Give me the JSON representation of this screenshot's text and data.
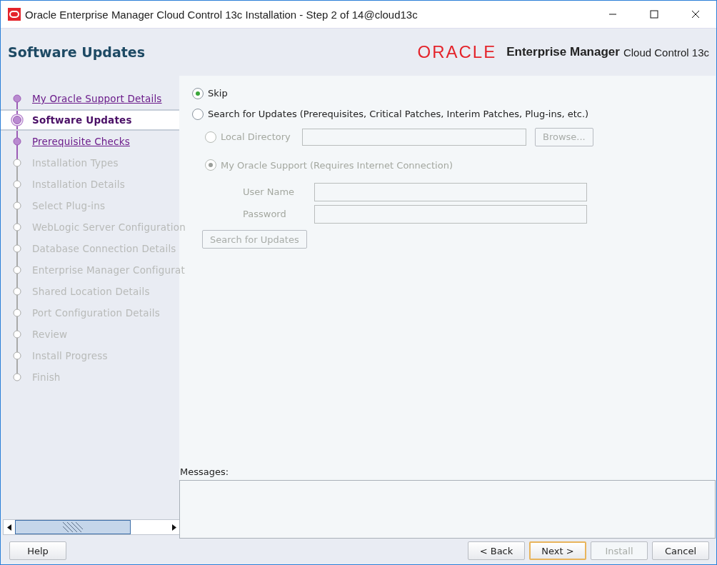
{
  "window": {
    "title": "Oracle Enterprise Manager Cloud Control 13c Installation - Step 2 of 14@cloud13c"
  },
  "header": {
    "title": "Software Updates",
    "brand": "ORACLE",
    "product": "Enterprise Manager",
    "product_suffix": "Cloud Control 13c"
  },
  "steps": [
    {
      "label": "My Oracle Support Details",
      "selected": false,
      "visited": true
    },
    {
      "label": "Software Updates",
      "selected": true,
      "visited": true
    },
    {
      "label": "Prerequisite Checks",
      "selected": false,
      "visited": true
    },
    {
      "label": "Installation Types",
      "selected": false,
      "visited": false
    },
    {
      "label": "Installation Details",
      "selected": false,
      "visited": false
    },
    {
      "label": "Select Plug-ins",
      "selected": false,
      "visited": false
    },
    {
      "label": "WebLogic Server Configuration",
      "selected": false,
      "visited": false
    },
    {
      "label": "Database Connection Details",
      "selected": false,
      "visited": false
    },
    {
      "label": "Enterprise Manager Configurat",
      "selected": false,
      "visited": false
    },
    {
      "label": "Shared Location Details",
      "selected": false,
      "visited": false
    },
    {
      "label": "Port Configuration Details",
      "selected": false,
      "visited": false
    },
    {
      "label": "Review",
      "selected": false,
      "visited": false
    },
    {
      "label": "Install Progress",
      "selected": false,
      "visited": false
    },
    {
      "label": "Finish",
      "selected": false,
      "visited": false
    }
  ],
  "options": [
    {
      "label": "Skip",
      "selected": true
    },
    {
      "label": "Search for Updates (Prerequisites, Critical Patches, Interim Patches, Plug-ins, etc.)",
      "selected": false
    }
  ],
  "local_directory": {
    "label": "Local Directory",
    "selected": false,
    "disabled": true,
    "browse": "Browse..."
  },
  "support": {
    "label": "My Oracle Support (Requires Internet Connection)",
    "selected": true,
    "disabled": true,
    "fields": [
      {
        "label": "User Name"
      },
      {
        "label": "Password"
      }
    ]
  },
  "search_button": {
    "label": "Search for Updates",
    "disabled": true
  },
  "messages": {
    "label": "Messages:"
  },
  "buttons": [
    {
      "label": "Help",
      "kind": "left",
      "disabled": false,
      "default": false
    },
    {
      "label": "< Back",
      "kind": "right",
      "disabled": false,
      "default": false
    },
    {
      "label": "Next >",
      "kind": "right",
      "disabled": false,
      "default": true
    },
    {
      "label": "Install",
      "kind": "right",
      "disabled": true,
      "default": false
    },
    {
      "label": "Cancel",
      "kind": "right",
      "disabled": false,
      "default": false
    }
  ]
}
